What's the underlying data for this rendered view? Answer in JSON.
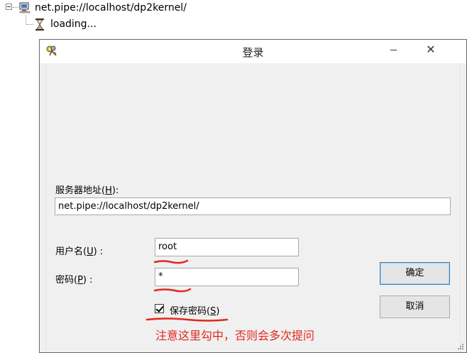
{
  "tree": {
    "root_label": "net.pipe://localhost/dp2kernel/",
    "child_label": "loading..."
  },
  "dialog": {
    "title": "登录",
    "server_label_text": "服务器地址(",
    "server_label_key": "H",
    "server_label_tail": "):",
    "server_value": "net.pipe://localhost/dp2kernel/",
    "username_label_text": "用户名(",
    "username_label_key": "U",
    "username_label_tail": ") :",
    "username_value": "root",
    "password_label_text": "密码(",
    "password_label_key": "P",
    "password_label_tail": ") :",
    "password_value": "*",
    "save_password_text": "保存密码(",
    "save_password_key": "S",
    "save_password_tail": ")",
    "save_password_checked": true,
    "ok_label": "确定",
    "cancel_label": "取消",
    "close_glyph": "✕"
  },
  "annotation": {
    "text": "注意这里勾中，否则会多次提问",
    "color": "#e0281f"
  }
}
